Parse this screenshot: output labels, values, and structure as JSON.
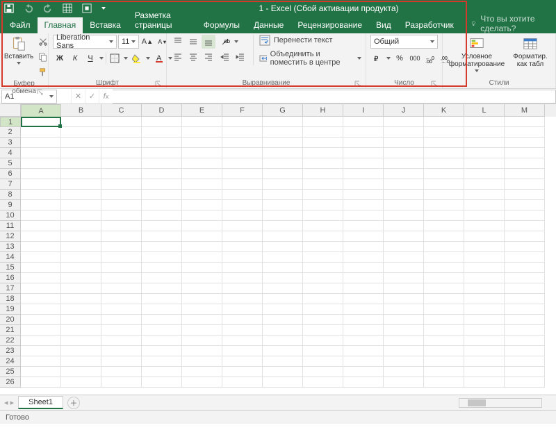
{
  "title": "1 - Excel (Сбой активации продукта)",
  "tabs": [
    "Файл",
    "Главная",
    "Вставка",
    "Разметка страницы",
    "Формулы",
    "Данные",
    "Рецензирование",
    "Вид",
    "Разработчик"
  ],
  "active_tab": 1,
  "tell_me": "Что вы хотите сделать?",
  "clipboard": {
    "paste": "Вставить",
    "label": "Буфер обмена"
  },
  "font": {
    "name": "Liberation Sans",
    "size": "11",
    "bold": "Ж",
    "italic": "К",
    "underline": "Ч",
    "label": "Шрифт"
  },
  "alignment": {
    "wrap": "Перенести текст",
    "merge": "Объединить и поместить в центре",
    "label": "Выравнивание"
  },
  "number": {
    "format": "Общий",
    "label": "Число"
  },
  "styles": {
    "cond": "Условное форматирование",
    "table": "Форматир. как табл",
    "label": "Стили"
  },
  "namebox": "A1",
  "cols": [
    "A",
    "B",
    "C",
    "D",
    "E",
    "F",
    "G",
    "H",
    "I",
    "J",
    "K",
    "L",
    "M"
  ],
  "row_count": 26,
  "sheet": "Sheet1",
  "status": "Готово"
}
